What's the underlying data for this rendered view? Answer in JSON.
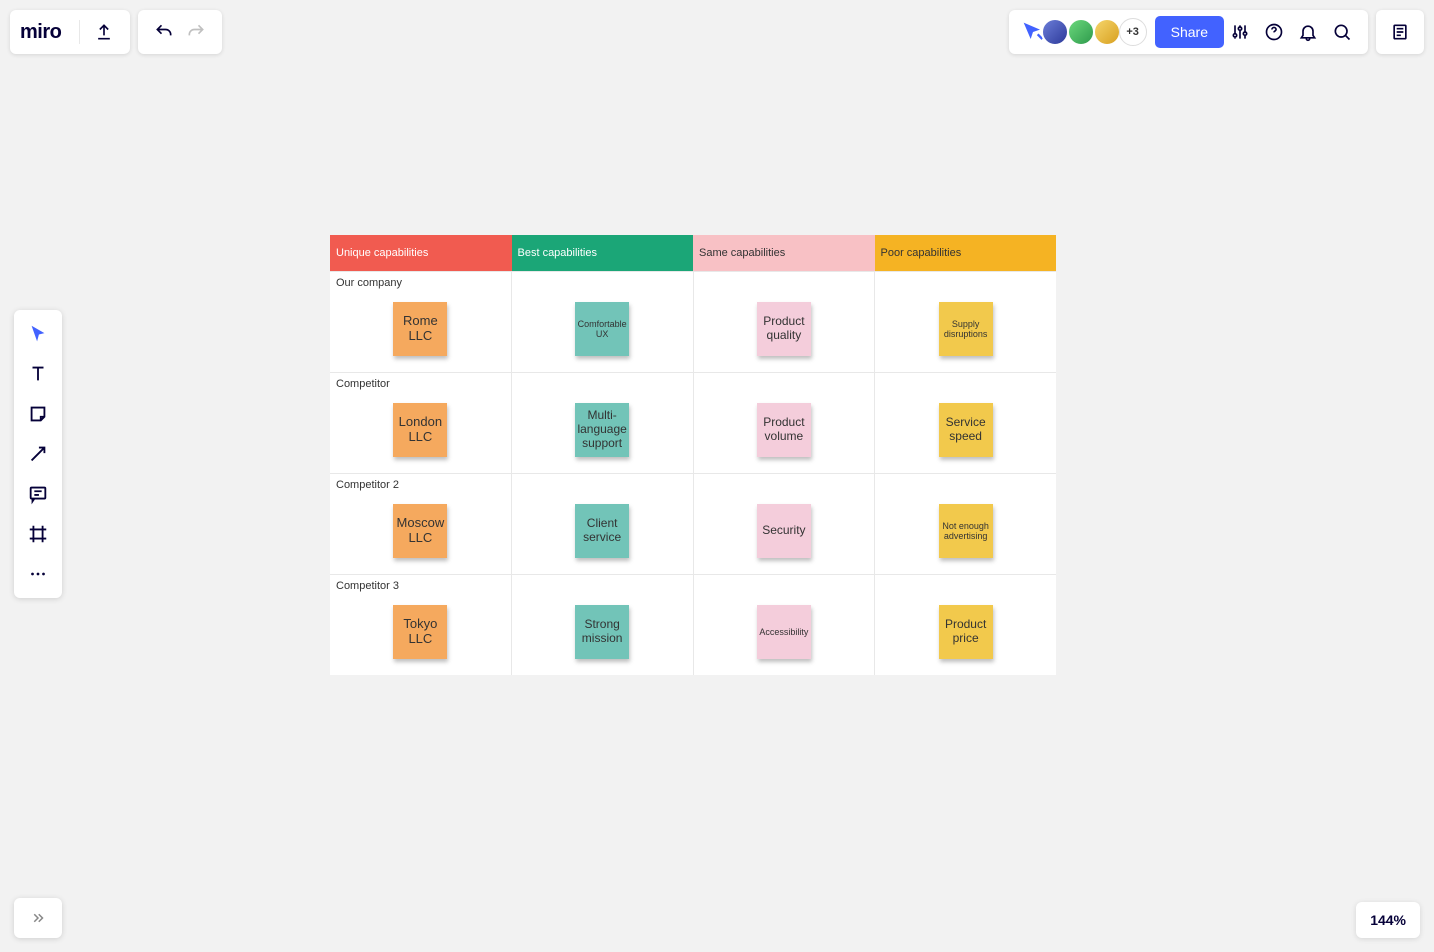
{
  "app": {
    "logo_text": "miro"
  },
  "top_right": {
    "more_avatars": "+3",
    "share_label": "Share"
  },
  "zoom": "144%",
  "table": {
    "headers": {
      "unique": "Unique capabilities",
      "best": "Best capabilities",
      "same": "Same capabilities",
      "poor": "Poor capabilities"
    },
    "rows": [
      {
        "label": "Our company",
        "cells": {
          "unique": "Rome LLC",
          "best": "Comfortable UX",
          "same": "Product quality",
          "poor": "Supply disruptions"
        }
      },
      {
        "label": "Competitor",
        "cells": {
          "unique": "London LLC",
          "best": "Multi-language support",
          "same": "Product volume",
          "poor": "Service speed"
        }
      },
      {
        "label": "Competitor 2",
        "cells": {
          "unique": "Moscow LLC",
          "best": "Client service",
          "same": "Security",
          "poor": "Not enough advertising"
        }
      },
      {
        "label": "Competitor 3",
        "cells": {
          "unique": "Tokyo LLC",
          "best": "Strong mission",
          "same": "Accessibility",
          "poor": "Product price"
        }
      }
    ]
  }
}
